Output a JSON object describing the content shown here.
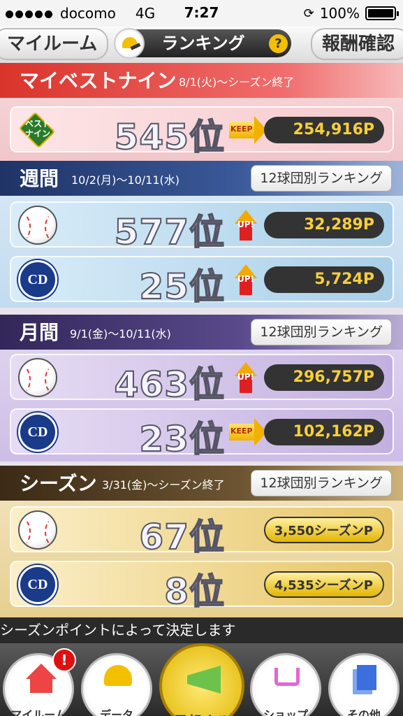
{
  "status_bar": {
    "carrier": "docomo",
    "network": "4G",
    "time": "7:27",
    "battery": "100%"
  },
  "header": {
    "left_button": "マイルーム",
    "title": "ランキング",
    "help": "?",
    "right_button": "報酬確認"
  },
  "sections": {
    "best_nine": {
      "title": "マイベストナイン",
      "date": "8/1(火)～シーズン終了",
      "card": {
        "icon_label": "ベスト\nナイン",
        "rank": "545位",
        "badge": "KEEP",
        "points": "254,916P"
      }
    },
    "weekly": {
      "title": "週間",
      "date": "10/2(月)～10/11(水)",
      "team_button": "12球団別ランキング",
      "cards": [
        {
          "icon": "baseball-icon",
          "rank": "577位",
          "badge": "UP!",
          "points": "32,289P"
        },
        {
          "icon": "team-logo-icon",
          "team_text": "CD",
          "rank": "25位",
          "badge": "UP!",
          "points": "5,724P"
        }
      ]
    },
    "monthly": {
      "title": "月間",
      "date": "9/1(金)～10/11(水)",
      "team_button": "12球団別ランキング",
      "cards": [
        {
          "icon": "baseball-icon",
          "rank": "463位",
          "badge": "UP!",
          "points": "296,757P"
        },
        {
          "icon": "team-logo-icon",
          "team_text": "CD",
          "rank": "23位",
          "badge": "KEEP",
          "points": "102,162P"
        }
      ]
    },
    "season": {
      "title": "シーズン",
      "date": "3/31(金)～シーズン終了",
      "team_button": "12球団別ランキング",
      "cards": [
        {
          "icon": "baseball-icon",
          "rank": "67位",
          "points": "3,550シーズンP"
        },
        {
          "icon": "team-logo-icon",
          "team_text": "CD",
          "rank": "8位",
          "points": "4,535シーズンP"
        }
      ]
    }
  },
  "ticker": "シーズンポイントによって決定します",
  "tabs": [
    {
      "label": "マイルーム",
      "notification": "!"
    },
    {
      "label": "データ"
    },
    {
      "label": "予想する"
    },
    {
      "label": "ショップ"
    },
    {
      "label": "その他"
    }
  ],
  "colors": {
    "best_nine": "#d9342b",
    "weekly": "#263b6c",
    "monthly": "#3b2d6b",
    "season": "#4a3520",
    "points_text": "#f7cf3a"
  }
}
